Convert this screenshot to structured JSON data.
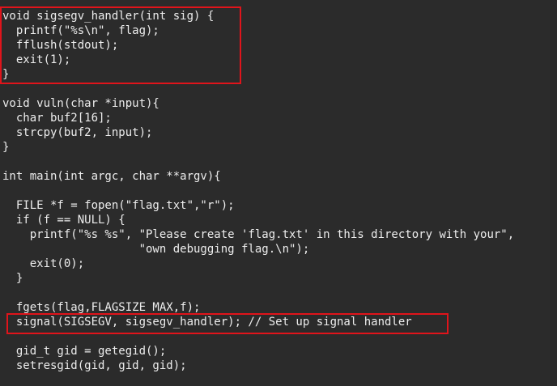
{
  "code": {
    "lines": [
      "void sigsegv_handler(int sig) {",
      "  printf(\"%s\\n\", flag);",
      "  fflush(stdout);",
      "  exit(1);",
      "}",
      "",
      "void vuln(char *input){",
      "  char buf2[16];",
      "  strcpy(buf2, input);",
      "}",
      "",
      "int main(int argc, char **argv){",
      "",
      "  FILE *f = fopen(\"flag.txt\",\"r\");",
      "  if (f == NULL) {",
      "    printf(\"%s %s\", \"Please create 'flag.txt' in this directory with your\",",
      "                    \"own debugging flag.\\n\");",
      "    exit(0);",
      "  }",
      "",
      "  fgets(flag,FLAGSIZE_MAX,f);",
      "  signal(SIGSEGV, sigsegv_handler); // Set up signal handler",
      "",
      "  gid_t gid = getegid();",
      "  setresgid(gid, gid, gid);"
    ]
  },
  "highlight_color": "#e0141b",
  "background_color": "#2b2b2b",
  "text_color": "#ededed"
}
